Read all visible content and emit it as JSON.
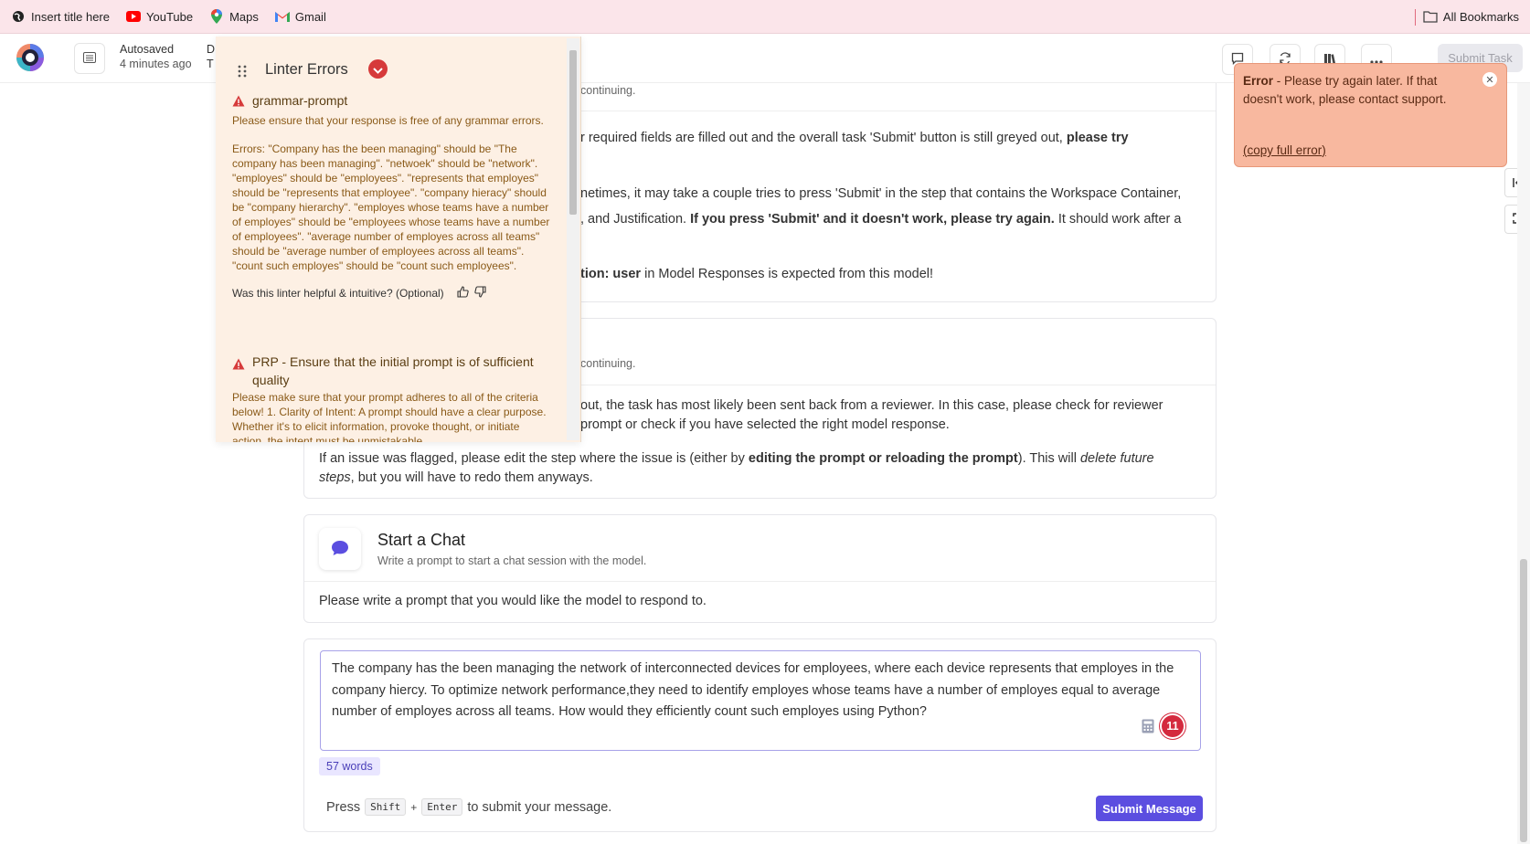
{
  "bookmarks": {
    "items": [
      {
        "label": "Insert title here",
        "icon": "globe-icon"
      },
      {
        "label": "YouTube",
        "icon": "youtube-icon"
      },
      {
        "label": "Maps",
        "icon": "maps-pin-icon"
      },
      {
        "label": "Gmail",
        "icon": "gmail-icon"
      }
    ],
    "all_bookmarks": "All Bookmarks"
  },
  "header": {
    "autosaved": "Autosaved",
    "autosaved_time": "4 minutes ago",
    "frag_top": "D",
    "frag_bottom": "T",
    "submit_task": "Submit Task"
  },
  "linter": {
    "title": "Linter Errors",
    "items": [
      {
        "title": "grammar-prompt",
        "desc": "Please ensure that your response is free of any grammar errors.",
        "errors": "Errors: \"Company has the been managing\" should be \"The company has been managing\". \"netwoek\" should be \"network\". \"employes\" should be \"employees\". \"represents that employes\" should be \"represents that employee\". \"company hieracy\" should be \"company hierarchy\". \"employes whose teams have a number of employes\" should be \"employees whose teams have a number of employees\". \"average number of employes across all teams\" should be \"average number of employees across all teams\". \"count such employes\" should be \"count such employees\".",
        "feedback": "Was this linter helpful & intuitive? (Optional)"
      },
      {
        "title": "PRP - Ensure that the initial prompt is of sufficient quality",
        "desc": "Please make sure that your prompt adheres to all of the criteria below! 1. Clarity of Intent: A prompt should have a clear purpose. Whether it's to elicit information, provoke thought, or initiate action, the intent must be unmistakable."
      }
    ]
  },
  "toast": {
    "prefix": "Error",
    "message": " - Please try again later. If that doesn't work, please contact support.",
    "copy_open": "(",
    "copy_link": "copy full error",
    "copy_close": ")"
  },
  "card1": {
    "sub": "continuing.",
    "p1_a": "r required fields are filled out and the overall task 'Submit' button is still greyed out, ",
    "p1_b": "please try",
    "p2_a": "netimes, it may take a couple tries to press 'Submit' in the step that contains the Workspace Container,",
    "p2_b": ", and Justification. ",
    "p2_c": "If you press 'Submit' and it doesn't work, please try again.",
    "p2_d": " It should work after a",
    "p3_a": "tion: user",
    "p3_b": " in Model Responses is expected from this model!"
  },
  "card2": {
    "sub": "continuing.",
    "p1_a": "out, the task has most likely been sent back from a reviewer. In this case, please check for reviewer",
    "p1_b": "prompt or check if you have selected the right model response.",
    "p2_a": "If an issue was flagged, please edit the step where the issue is (either by ",
    "p2_b": "editing the prompt or reloading the prompt",
    "p2_c": "). This will ",
    "p2_d": "delete future",
    "p2_e": "steps",
    "p2_f": ", but you will have to redo them anyways."
  },
  "chat": {
    "title": "Start a Chat",
    "subtitle": "Write a prompt to start a chat session with the model.",
    "instruction": "Please write a prompt that you would like the model to respond to."
  },
  "prompt": {
    "text": "The company has the been managing the network of interconnected devices for employees, where each device represents that employes in the company hiercy. To optimize network performance,they need to identify employes whose teams have a number of employes equal to average number of employes across all teams. How would they efficiently count such employes using Python?",
    "badge": "11",
    "word_count": "57 words",
    "press": "Press",
    "key1": "Shift",
    "plus": "+",
    "key2": "Enter",
    "press_tail": "to submit your message.",
    "submit": "Submit Message"
  },
  "colors": {
    "accent": "#5b4ee0",
    "error": "#d42a3e",
    "toast_bg": "#f8b89f",
    "linter_bg": "#fdf0e4"
  }
}
